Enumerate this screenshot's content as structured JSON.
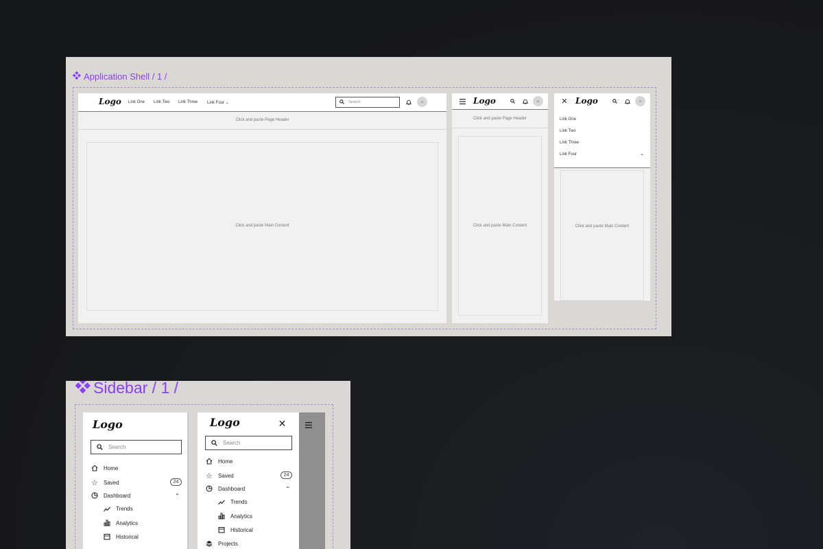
{
  "colors": {
    "accent": "#8b3ff2",
    "canvas": "#18191b",
    "frame": "#d9d8d5",
    "panel": "#f1f1f1"
  },
  "app_shell": {
    "title": "Application Shell / 1 /",
    "component_icon": "component-diamond-icon",
    "desktop": {
      "logo": "Logo",
      "links": [
        "Link One",
        "Link Two",
        "Link Three",
        "Link Four"
      ],
      "search_placeholder": "Search",
      "avatar": "JD",
      "page_header": "Click and paste Page Header",
      "main_content": "Click and paste Main Content"
    },
    "tablet": {
      "logo": "Logo",
      "avatar": "JD",
      "page_header": "Click and paste Page Header",
      "main_content": "Click and paste Main Content"
    },
    "mobile": {
      "logo": "Logo",
      "avatar": "JD",
      "menu_links": [
        "Link One",
        "Link Two",
        "Link Three",
        "Link Four"
      ],
      "main_content": "Click and paste Main Content"
    }
  },
  "sidebar": {
    "title": "Sidebar / 1 /",
    "component_icon": "component-diamond-icon",
    "expanded": {
      "logo": "Logo",
      "search_placeholder": "Search",
      "items": [
        {
          "label": "Home",
          "icon": "home-icon"
        },
        {
          "label": "Saved",
          "icon": "star-icon",
          "badge": "24"
        },
        {
          "label": "Dashboard",
          "icon": "pie-chart-icon"
        },
        {
          "label": "Trends",
          "icon": "trend-icon"
        },
        {
          "label": "Analytics",
          "icon": "bar-chart-icon"
        },
        {
          "label": "Historical",
          "icon": "calendar-icon"
        }
      ]
    },
    "overlay": {
      "logo": "Logo",
      "search_placeholder": "Search",
      "items": [
        {
          "label": "Home",
          "icon": "home-icon"
        },
        {
          "label": "Saved",
          "icon": "star-icon",
          "badge": "24"
        },
        {
          "label": "Dashboard",
          "icon": "pie-chart-icon"
        },
        {
          "label": "Trends",
          "icon": "trend-icon"
        },
        {
          "label": "Analytics",
          "icon": "bar-chart-icon"
        },
        {
          "label": "Historical",
          "icon": "calendar-icon"
        },
        {
          "label": "Projects",
          "icon": "layers-icon"
        }
      ]
    }
  }
}
